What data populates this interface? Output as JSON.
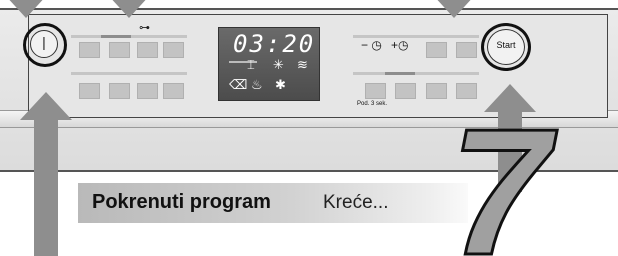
{
  "panel": {
    "power_button": {
      "symbol": "|"
    },
    "display": {
      "time": "03:20"
    },
    "lock_icon": "key-icon",
    "timer": {
      "minus_label": "−",
      "plus_label": "+"
    },
    "start_button": {
      "label": "Start"
    },
    "hold_hint": "Pod. 3 sek."
  },
  "caption": {
    "bold": "Pokrenuti program",
    "rest": "Kreće..."
  },
  "step_number": "7",
  "colors": {
    "arrow": "#8e8e8e",
    "display_bg": "#555555",
    "caption_grad": "#b9b9b9"
  }
}
